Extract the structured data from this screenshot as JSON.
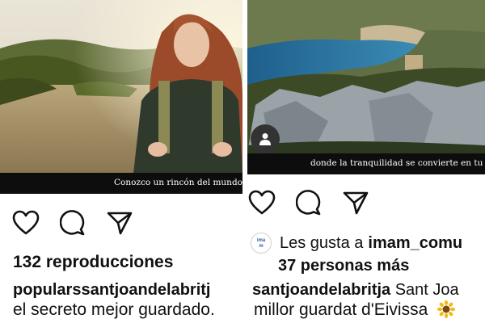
{
  "left_post": {
    "video_caption": "Conozco un rincón del mundo",
    "views_text": "132 reproducciones",
    "username": "popularssantjoandelabritj",
    "caption": "el secreto mejor guardado.",
    "icons": [
      "heart-icon",
      "comment-icon",
      "share-icon"
    ]
  },
  "right_post": {
    "video_caption": "donde la tranquilidad  se convierte en tu me",
    "likes_prefix": "Les gusta a",
    "likes_user": "imam_comu",
    "likes_others": "37 personas más",
    "liker_avatar_text": "ima m",
    "username": "santjoandelabritja",
    "username_suffix": "Sant Joa",
    "caption": "millor guardat d'Eivissa",
    "emoji_icon": "sunflower-emoji",
    "icons": [
      "heart-icon",
      "comment-icon",
      "share-icon",
      "user-icon"
    ]
  },
  "colors": {
    "text": "#111111",
    "caption_bar": "#0d0d0d",
    "caption_text": "#ffffff"
  }
}
